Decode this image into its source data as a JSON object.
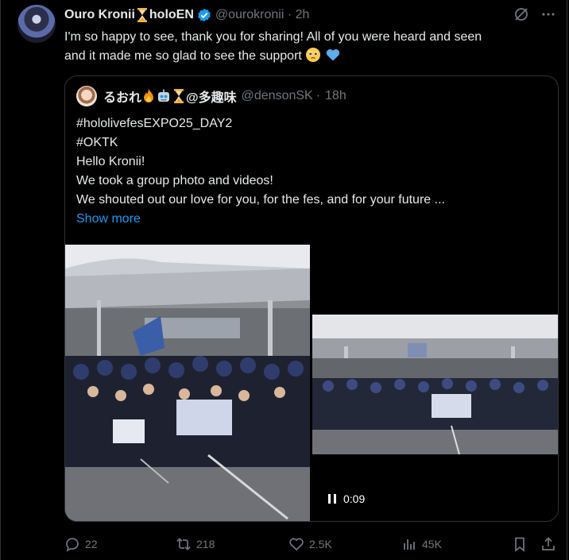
{
  "author": {
    "name": "Ouro Kronii",
    "org": "holoEN",
    "handle": "@ourokronii",
    "time": "2h"
  },
  "tweet": {
    "line1": "I'm so happy to see, thank you for sharing! All of you were heard and seen",
    "line2": "and it made me so glad to see the support"
  },
  "quote": {
    "name_left": "るおれ",
    "name_right": "@多趣味",
    "handle": "@densonSK",
    "time": "18h",
    "lines": [
      "#hololivefesEXPO25_DAY2",
      "#OKTK",
      "Hello Kronii!",
      "We took a group photo and videos!",
      "We shouted out our love for you, for the fes, and for your future ..."
    ],
    "show_more": "Show more",
    "video_time": "0:09"
  },
  "actions": {
    "replies": "22",
    "reposts": "218",
    "likes": "2.5K",
    "views": "45K"
  },
  "colors": {
    "link": "#1d9bf0",
    "muted": "#71767b",
    "verified": "#1d9bf0",
    "border": "#2f3336"
  }
}
